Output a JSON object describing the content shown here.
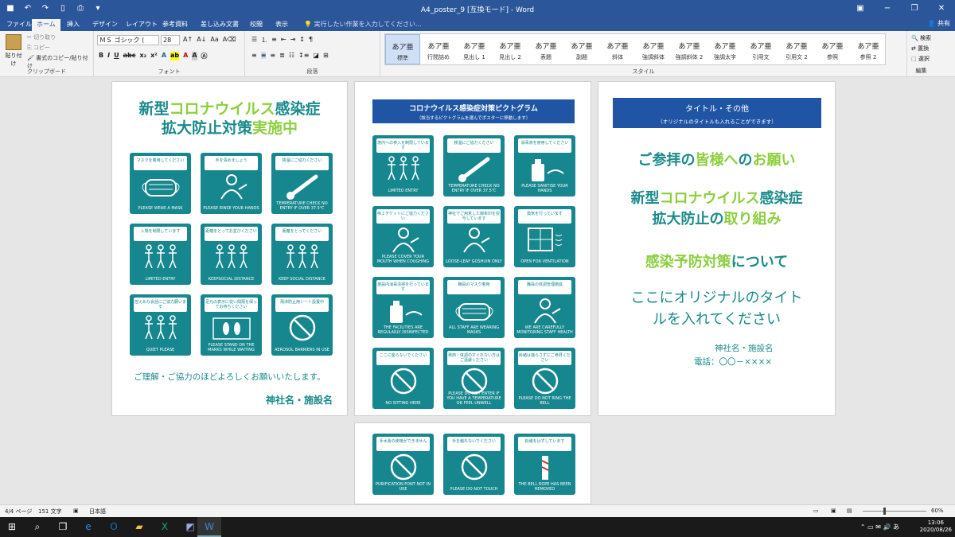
{
  "titlebar": {
    "title": "A4_poster_9 [互換モード] - Word",
    "signin_label": ""
  },
  "tabs": [
    "ファイル",
    "ホーム",
    "挿入",
    "デザイン",
    "レイアウト",
    "参考資料",
    "差し込み文書",
    "校閲",
    "表示"
  ],
  "tellme": "実行したい作業を入力してください...",
  "share": "共有",
  "ribbon": {
    "clipboard": {
      "paste": "貼り付け",
      "cut": "切り取り",
      "copy": "コピー",
      "format_painter": "書式のコピー/貼り付け",
      "label": "クリップボード"
    },
    "font": {
      "name": "ＭＳ ゴシック (",
      "size": "28",
      "label": "フォント"
    },
    "paragraph": {
      "label": "段落"
    },
    "styles": {
      "label": "スタイル",
      "items": [
        {
          "preview": "あア亜",
          "name": "標準"
        },
        {
          "preview": "あア亜",
          "name": "行間詰め"
        },
        {
          "preview": "あア亜",
          "name": "見出し 1"
        },
        {
          "preview": "あア亜",
          "name": "見出し 2"
        },
        {
          "preview": "あア亜",
          "name": "表題"
        },
        {
          "preview": "あア亜",
          "name": "副題"
        },
        {
          "preview": "あア亜",
          "name": "斜体"
        },
        {
          "preview": "あア亜",
          "name": "強調斜体"
        },
        {
          "preview": "あア亜",
          "name": "強調斜体 2"
        },
        {
          "preview": "あア亜",
          "name": "強調太字"
        },
        {
          "preview": "あア亜",
          "name": "引用文"
        },
        {
          "preview": "あア亜",
          "name": "引用文 2"
        },
        {
          "preview": "あア亜",
          "name": "参照"
        },
        {
          "preview": "あア亜",
          "name": "参照 2"
        }
      ]
    },
    "editing": {
      "find": "検索",
      "replace": "置換",
      "select": "選択",
      "label": "編集"
    }
  },
  "page1": {
    "title_line1_a": "新型",
    "title_line1_b": "コロナウイルス",
    "title_line1_c": "感染症",
    "title_line2_a": "拡大防止対策",
    "title_line2_b": "実施中",
    "tiles": [
      {
        "head": "マスクを着用してください",
        "foot": "PLEASE WEAR A MASK",
        "icon": "mask-icon"
      },
      {
        "head": "手を清めましょう",
        "foot": "PLEASE RINSE YOUR HANDS",
        "icon": "hand-wash-icon"
      },
      {
        "head": "検温にご協力ください",
        "foot": "TEMPERATURE CHECK NO ENTRY IF OVER 37.5℃",
        "icon": "thermometer-icon"
      },
      {
        "head": "入場を制限しています",
        "foot": "LIMITED ENTRY",
        "icon": "people-icon"
      },
      {
        "head": "距離をとってお並びください",
        "foot": "KEEPSOCIAL DISTANCE",
        "icon": "queue-icon"
      },
      {
        "head": "距離をとってください",
        "foot": "KEEP SOCIAL DISTANCE",
        "icon": "distance-icon"
      },
      {
        "head": "控えめな会話にご協力願います",
        "foot": "QUIET PLEASE",
        "icon": "quiet-icon"
      },
      {
        "head": "足元の表示に従い間隔を保ってお待ちください",
        "foot": "PLEASE STAND ON THE MARKS WHILE WAITING",
        "icon": "footprints-icon"
      },
      {
        "head": "飛沫防止用シート設置中",
        "foot": "AEROSOL BARRIERS IN USE",
        "icon": "barrier-icon"
      }
    ],
    "closing": "ご理解・ご協力のほどよろしくお願いいたします。",
    "org": "神社名・施設名"
  },
  "page2": {
    "banner_title": "コロナウイルス感染症対策ピクトグラム",
    "banner_sub": "（該当するピクトグラムを選んでポスターに移動します）",
    "tiles": [
      {
        "head": "境内への参入を制限しています",
        "foot": "LIMITED ENTRY",
        "icon": "shrine-people-icon"
      },
      {
        "head": "検温にご協力ください",
        "foot": "TEMPERATURE CHECK NO ENTRY IF OVER 37.5℃",
        "icon": "thermo-gun-icon"
      },
      {
        "head": "消毒液を使用してください",
        "foot": "PLEASE SANITISE YOUR HANDS",
        "icon": "sanitizer-icon"
      },
      {
        "head": "咳エチケットにご協力ください",
        "foot": "PLEASE COVER YOUR MOUTH WHEN COUGHING",
        "icon": "cough-icon"
      },
      {
        "head": "神社でご用意した御朱印を授与しています",
        "foot": "LOOSE-LEAF GOSHUIN ONLY",
        "icon": "goshuin-icon"
      },
      {
        "head": "換気を行っています",
        "foot": "OPEN FOR VENTILATION",
        "icon": "window-icon"
      },
      {
        "head": "施設内消毒清掃を行っています",
        "foot": "THE FACILITIES ARE REGULARLY DISINFECTED",
        "icon": "spray-icon"
      },
      {
        "head": "職員のマスク着用",
        "foot": "ALL STAFF ARE WEARING MASKS",
        "icon": "staff-mask-icon"
      },
      {
        "head": "職員の体調管理徹底",
        "foot": "WE ARE CAREFULLY MONITORING STAFF HEALTH",
        "icon": "staff-health-icon"
      },
      {
        "head": "ここに座らないでください",
        "foot": "NO SITTING HERE",
        "icon": "no-sitting-icon"
      },
      {
        "head": "発熱・体調のすぐれない方はご遠慮ください",
        "foot": "PLEASE DO NOT ENTER IF YOU HAVE A TEMPERATURE OR FEEL UNWELL",
        "icon": "no-entry-fever-icon"
      },
      {
        "head": "鈴緒は揺らさずにご参拝ください",
        "foot": "PLEASE DO NOT RING THE BELL",
        "icon": "no-bell-icon"
      },
      {
        "head": "手水舎の使用ができません",
        "foot": "PURIFICATION FONT NOT IN USE",
        "icon": "no-font-icon"
      },
      {
        "head": "手を触れないでください",
        "foot": "PLEASE DO NOT TOUCH",
        "icon": "no-touch-icon"
      },
      {
        "head": "鈴緒をはずしています",
        "foot": "THE BELL ROPE HAS BEEN REMOVED",
        "icon": "bell-rope-icon"
      }
    ]
  },
  "page3": {
    "banner_title": "タイトル・その他",
    "banner_sub": "（オリジナルのタイトルも入れることができます）",
    "line1_a": "ご参拝の",
    "line1_b": "皆様へ",
    "line1_c": "の",
    "line1_d": "お願い",
    "line2_a": "新型",
    "line2_b": "コロナウイルス",
    "line2_c": "感染症",
    "line3_a": "拡大防止の",
    "line3_b": "取り組み",
    "line4_a": "感染予防対策",
    "line4_b": "について",
    "line5": "ここにオリジナルのタイト",
    "line6": "ルを入れてください",
    "org": "神社名・施設名",
    "phone": "電話：〇〇－××××"
  },
  "status": {
    "page": "4/4 ページ",
    "words": "151 文字",
    "lang": "日本語",
    "zoom": "60%"
  },
  "clock": {
    "time": "13:06",
    "date": "2020/08/26"
  },
  "colors": {
    "teal": "#16878e",
    "green": "#8ccf3e",
    "word_blue": "#2b579a",
    "banner_blue": "#1f55a4"
  }
}
